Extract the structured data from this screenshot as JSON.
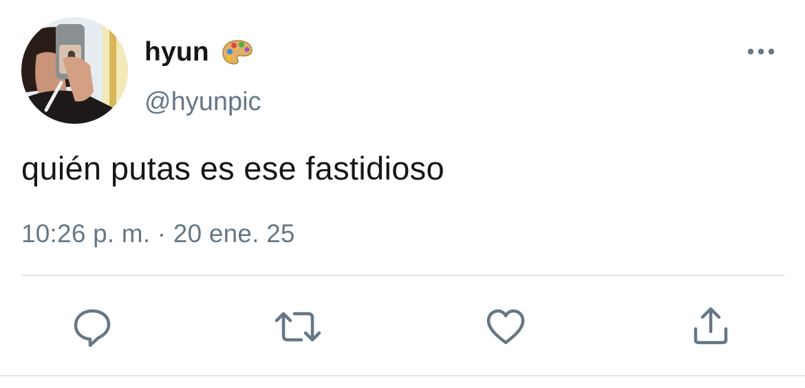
{
  "user": {
    "display_name": "hyun",
    "name_emoji": "artist-palette-emoji",
    "handle": "@hyunpic",
    "avatar": "user-avatar-photo"
  },
  "tweet": {
    "text": "quién putas es ese fastidioso",
    "timestamp": "10:26 p. m. · 20 ene. 25"
  },
  "icons": {
    "more": "more-options-icon",
    "reply": "reply-icon",
    "retweet": "retweet-icon",
    "like": "like-icon",
    "share": "share-icon"
  },
  "colors": {
    "text_primary": "#14171a",
    "text_secondary": "#657786",
    "icon": "#657786",
    "divider": "#e1e8ed",
    "background": "#ffffff"
  }
}
